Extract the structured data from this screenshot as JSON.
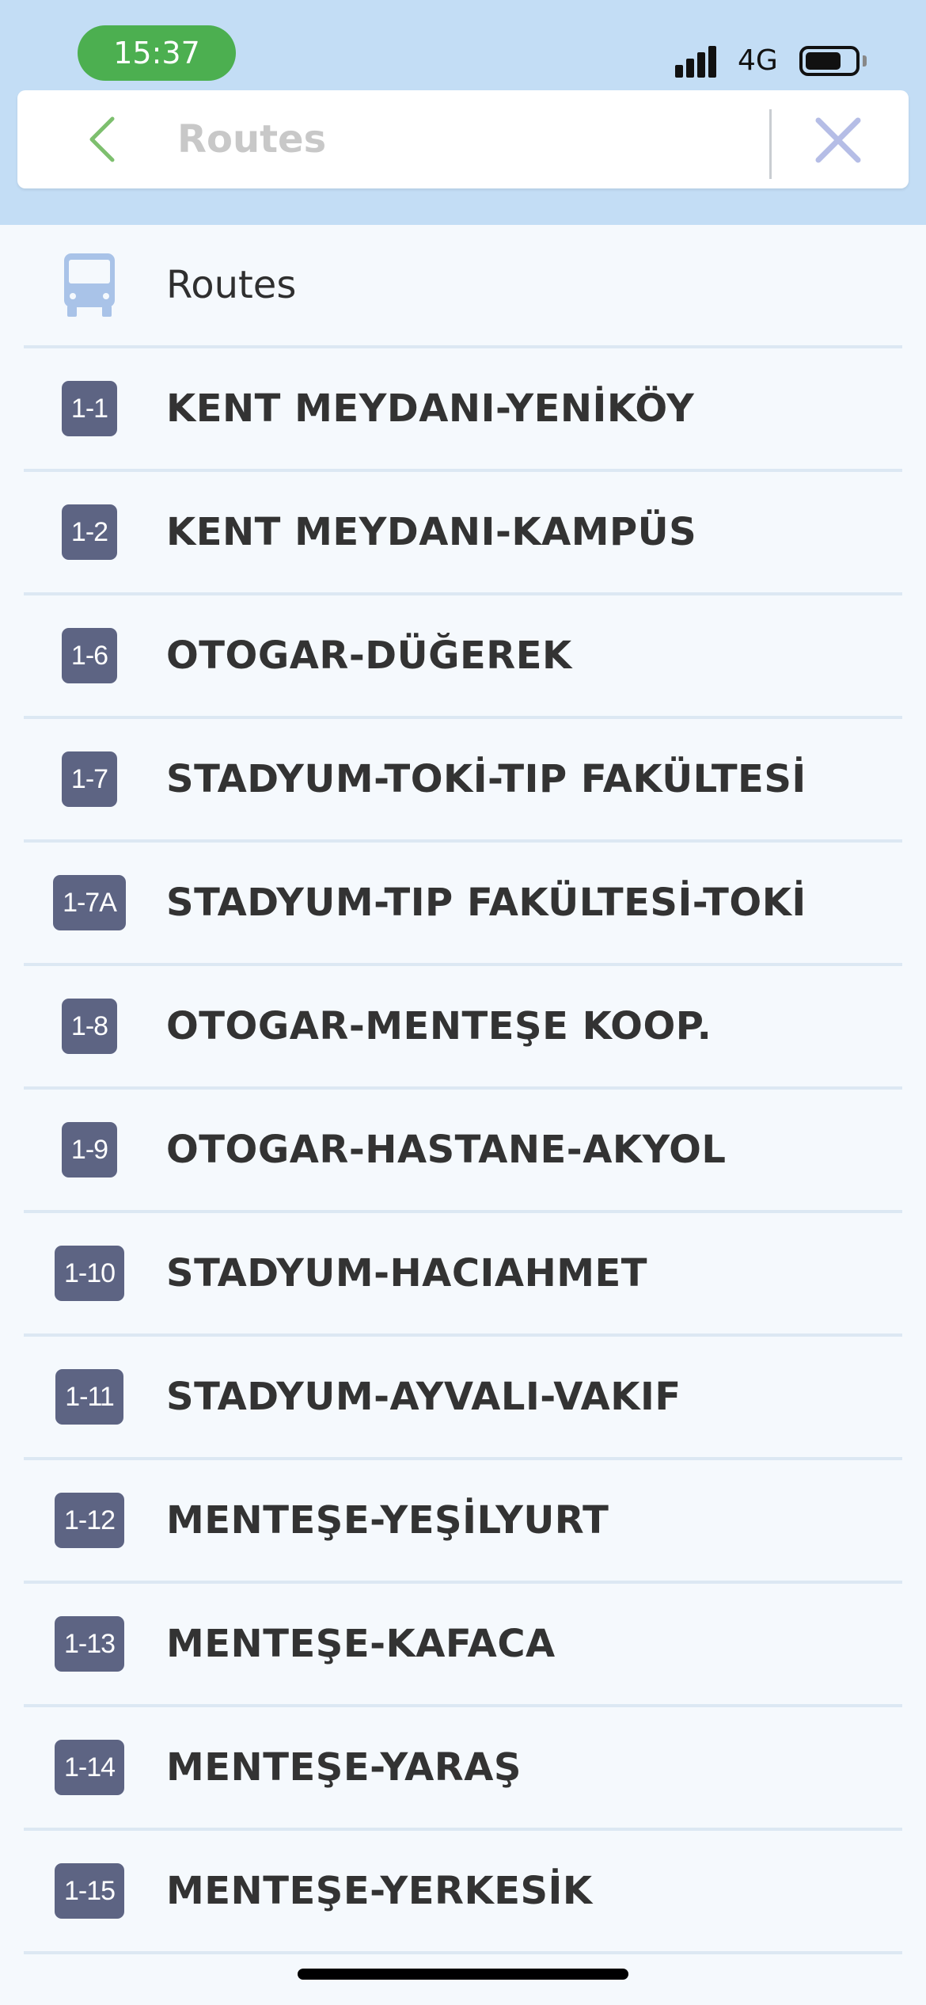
{
  "status_bar": {
    "time": "15:37",
    "network": "4G",
    "colors": {
      "time_pill": "#4caf50"
    }
  },
  "search": {
    "placeholder": "Routes",
    "back_icon": "chevron-left-icon",
    "clear_icon": "close-icon"
  },
  "header_row": {
    "icon": "bus-icon",
    "label": "Routes"
  },
  "routes": [
    {
      "code": "1-1",
      "name": "KENT MEYDANI-YENİKÖY"
    },
    {
      "code": "1-2",
      "name": "KENT MEYDANI-KAMPÜS"
    },
    {
      "code": "1-6",
      "name": "OTOGAR-DÜĞEREK"
    },
    {
      "code": "1-7",
      "name": "STADYUM-TOKİ-TIP FAKÜLTESİ"
    },
    {
      "code": "1-7A",
      "name": "STADYUM-TIP FAKÜLTESİ-TOKİ"
    },
    {
      "code": "1-8",
      "name": "OTOGAR-MENTEŞE KOOP."
    },
    {
      "code": "1-9",
      "name": "OTOGAR-HASTANE-AKYOL"
    },
    {
      "code": "1-10",
      "name": "STADYUM-HACIAHMET"
    },
    {
      "code": "1-11",
      "name": "STADYUM-AYVALI-VAKIF"
    },
    {
      "code": "1-12",
      "name": "MENTEŞE-YEŞİLYURT"
    },
    {
      "code": "1-13",
      "name": "MENTEŞE-KAFACA"
    },
    {
      "code": "1-14",
      "name": "MENTEŞE-YARAŞ"
    },
    {
      "code": "1-15",
      "name": "MENTEŞE-YERKESİK"
    }
  ],
  "colors": {
    "header_bg": "#c3ddf5",
    "list_bg": "#f5f9fd",
    "badge": "#5d6483",
    "back_chevron": "#7dbf6e",
    "close_x": "#b5bde6",
    "bus_icon": "#a9c3e8"
  }
}
